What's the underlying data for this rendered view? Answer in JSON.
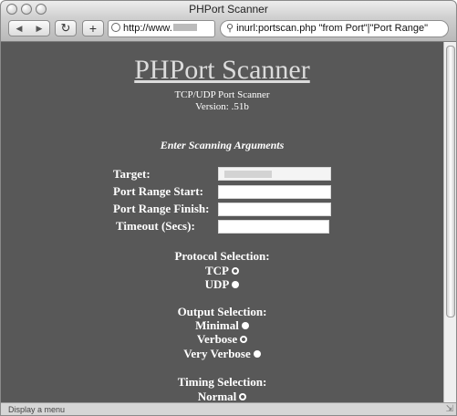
{
  "window": {
    "title": "PHPort Scanner"
  },
  "toolbar": {
    "back_icon": "back-arrow-icon",
    "forward_icon": "forward-arrow-icon",
    "reload_icon": "reload-icon",
    "add_icon": "plus-icon",
    "url_prefix": "http://www.",
    "search_text": "inurl:portscan.php \"from Port\"|\"Port Range\""
  },
  "status": {
    "text": "Display a menu"
  },
  "page": {
    "title": "PHPort Scanner",
    "subtitle": "TCP/UDP Port Scanner",
    "version": "Version: .51b",
    "section_heading": "Enter Scanning Arguments",
    "form": {
      "target_label": "Target:",
      "range_start_label": "Port Range Start:",
      "range_finish_label": "Port Range Finish:",
      "timeout_label": "Timeout (Secs):"
    },
    "protocol": {
      "heading": "Protocol Selection:",
      "options": [
        {
          "label": "TCP",
          "selected": false
        },
        {
          "label": "UDP",
          "selected": true
        }
      ]
    },
    "output": {
      "heading": "Output Selection:",
      "options": [
        {
          "label": "Minimal",
          "selected": true
        },
        {
          "label": "Verbose",
          "selected": false
        },
        {
          "label": "Very Verbose",
          "selected": true
        }
      ]
    },
    "timing": {
      "heading": "Timing Selection:",
      "options": [
        {
          "label": "Normal",
          "selected": false
        }
      ]
    }
  },
  "colors": {
    "page_background": "#585858",
    "text": "#ffffff"
  }
}
